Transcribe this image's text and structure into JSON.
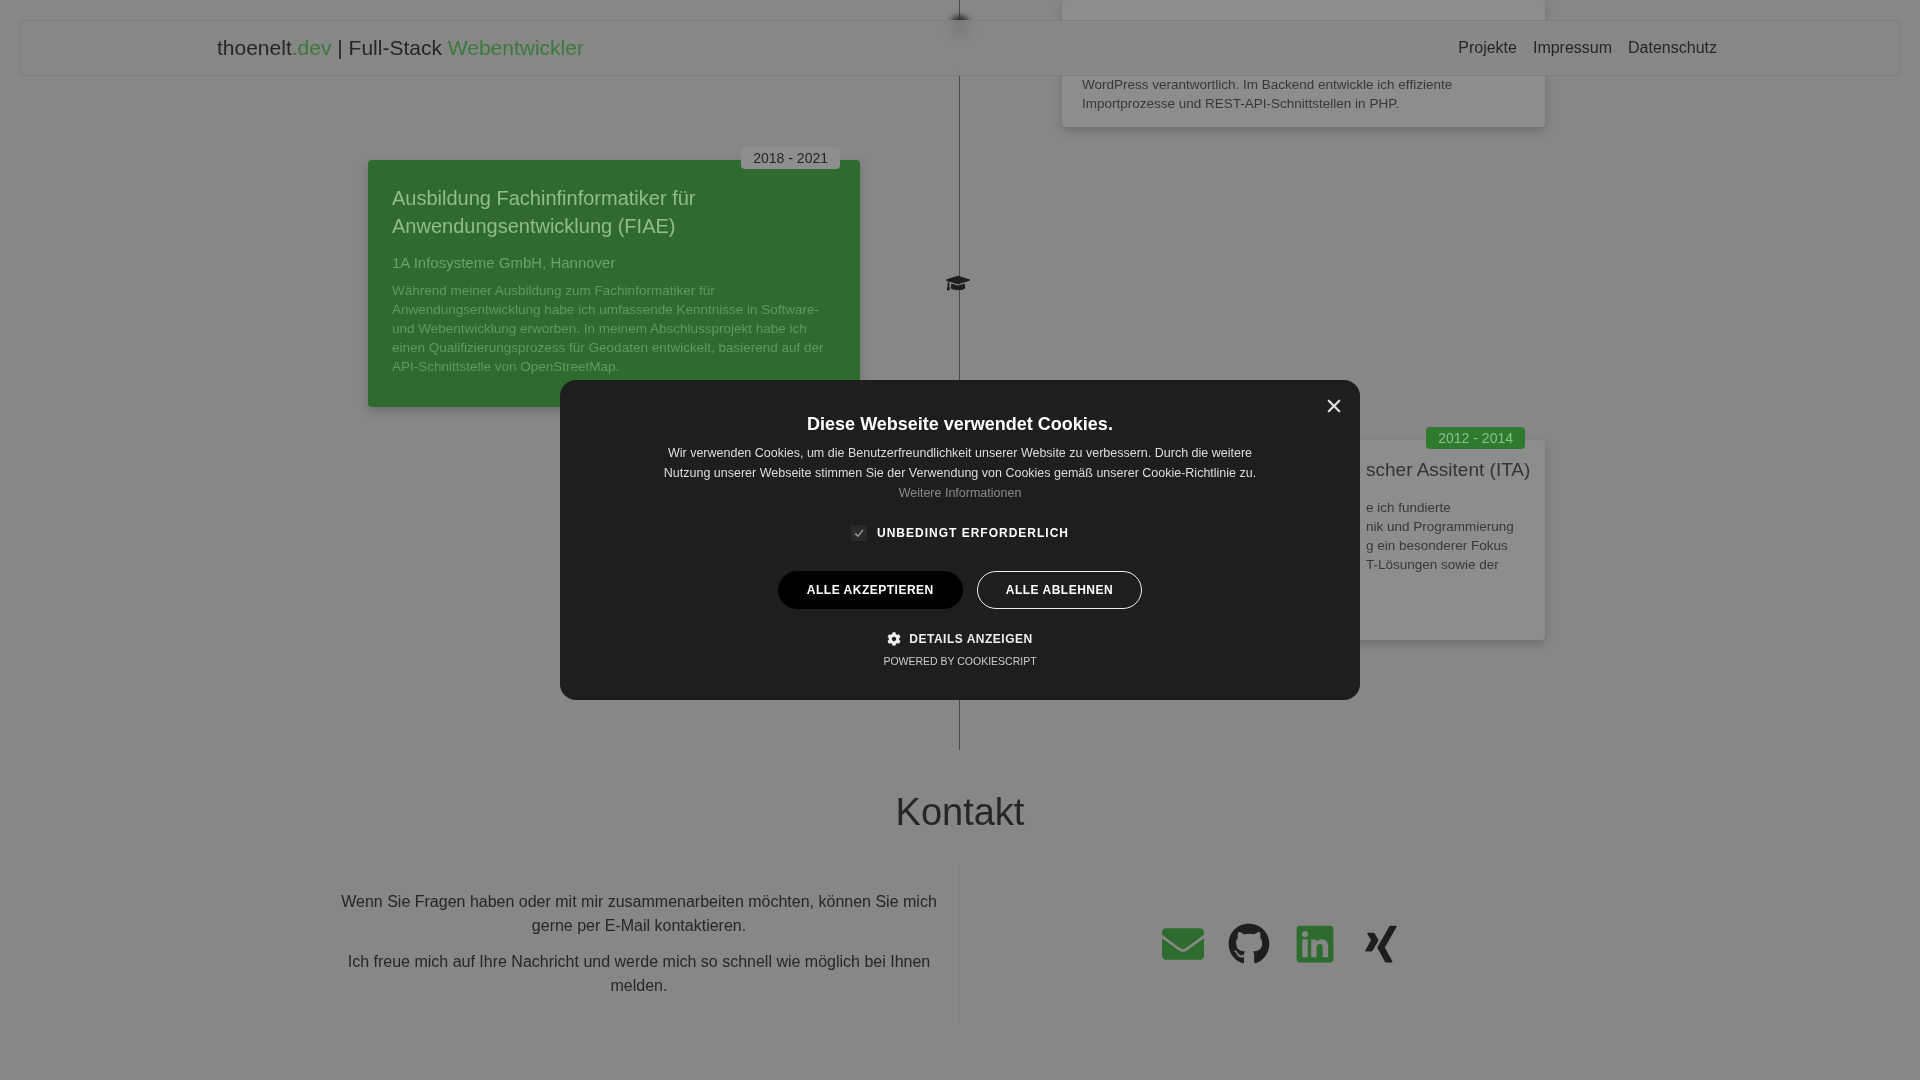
{
  "header": {
    "brand": {
      "name": "thoenelt",
      "tld": ".dev",
      "separator": "|",
      "tagline": "Full-Stack",
      "tagline_highlight": "Webentwickler"
    },
    "nav": [
      {
        "label": "Projekte"
      },
      {
        "label": "Impressum"
      },
      {
        "label": "Datenschutz"
      }
    ]
  },
  "timeline": {
    "entries": [
      {
        "highlighted": false,
        "description_lines": [
          "WordPress verantwortlich. Im Backend entwickle ich effiziente",
          "Importprozesse und REST-API-Schnittstellen in PHP."
        ]
      },
      {
        "highlighted": true,
        "period": "2018 - 2021",
        "title": "Ausbildung Fachinfinformatiker für Anwendungsentwicklung (FIAE)",
        "company": "1A Infosysteme GmbH, Hannover",
        "description": "Während meiner Ausbildung zum Fachinformatiker für Anwendungsentwicklung habe ich umfassende Kenntnisse in Software- und Webentwicklung erworben. In meinem Abschlussprojekt habe ich einen Qualifizierungsprozess für Geodaten entwickelt, basierend auf der API-Schnittstelle von OpenStreetMap."
      },
      {
        "highlighted": false,
        "period": "2012 - 2014",
        "title": "scher Assitent (ITA)",
        "description_lines": [
          "e ich fundierte",
          "nik und Programmierung",
          "g ein besonderer Fokus",
          "T-Lösungen sowie der"
        ]
      }
    ]
  },
  "contact": {
    "heading": "Kontakt",
    "paragraphs": [
      "Wenn Sie Fragen haben oder mit mir zusammenarbeiten möchten, können Sie mich gerne per E-Mail kontaktieren.",
      "Ich freue mich auf Ihre Nachricht und werde mich so schnell wie möglich bei Ihnen melden."
    ],
    "links": [
      {
        "kind": "email",
        "color": "#2e6b2e"
      },
      {
        "kind": "github",
        "color": "#1e1e1e"
      },
      {
        "kind": "linkedin",
        "color": "#2e6b2e"
      },
      {
        "kind": "xing",
        "color": "#1e1e1e"
      }
    ]
  },
  "cookie_dialog": {
    "title": "Diese Webseite verwendet Cookies.",
    "text": "Wir verwenden Cookies, um die Benutzerfreundlichkeit unserer Website zu verbessern. Durch die weitere Nutzung unserer Webseite stimmen Sie der Verwendung von Cookies gemäß unserer Cookie-Richtlinie zu.",
    "link": "Weitere Informationen",
    "categories": [
      {
        "label": "UNBEDINGT ERFORDERLICH",
        "checked": true
      }
    ],
    "buttons": [
      {
        "label": "ALLE AKZEPTIEREN",
        "kind": "primary"
      },
      {
        "label": "ALLE ABLEHNEN",
        "kind": "outline"
      }
    ],
    "details": "DETAILS ANZEIGEN",
    "powered_by": "POWERED BY COOKIESCRIPT"
  }
}
